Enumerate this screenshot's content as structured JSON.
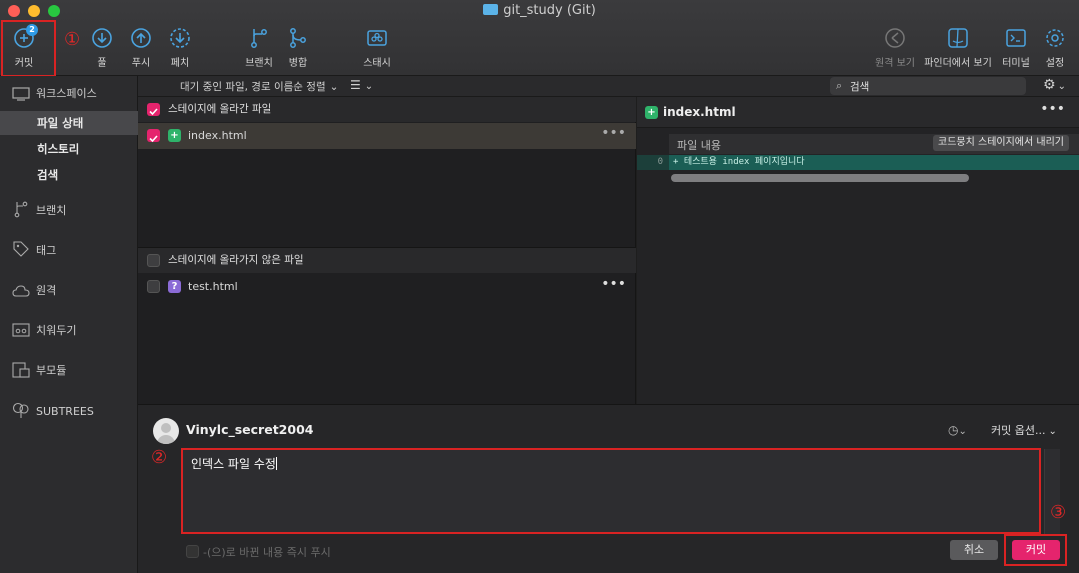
{
  "window": {
    "title": "git_study (Git)"
  },
  "toolbar": {
    "commit_label": "커밋",
    "commit_badge": "2",
    "pull_label": "풀",
    "push_label": "푸시",
    "fetch_label": "페치",
    "branch_label": "브랜치",
    "merge_label": "병합",
    "stash_label": "스태시",
    "remote_label": "원격 보기",
    "finder_label": "파인더에서 보기",
    "terminal_label": "터미널",
    "settings_label": "설정"
  },
  "annotations": {
    "one": "①",
    "two": "②",
    "three": "③"
  },
  "sidebar": {
    "workspace": "워크스페이스",
    "file_status": "파일 상태",
    "history": "히스토리",
    "search": "검색",
    "branches": "브랜치",
    "tags": "태그",
    "remotes": "원격",
    "stashes": "치워두기",
    "submodules": "부모듈",
    "subtrees": "SUBTREES"
  },
  "listbar": {
    "sort_label": "대기 중인 파일, 경로 이름순 정렬",
    "search_placeholder": "검색"
  },
  "staged": {
    "header": "스테이지에 올라간 파일",
    "files": [
      {
        "name": "index.html",
        "status": "added",
        "checked": true
      }
    ]
  },
  "unstaged": {
    "header": "스테이지에 올라가지 않은 파일",
    "files": [
      {
        "name": "test.html",
        "status": "untracked",
        "checked": false
      }
    ]
  },
  "diff": {
    "file_name": "index.html",
    "hunk_label": "파일 내용",
    "unstage_button": "코드뭉치 스테이지에서 내리기",
    "line_number": "0",
    "added_line": "+ 테스트용 index 페이지입니다"
  },
  "commit": {
    "author": "Vinylc_secret2004",
    "options_label": "커밋 옵션...",
    "message": "인덱스 파일 수정",
    "push_immediately": "-(으)로 바뀐 내용 즉시 푸시",
    "cancel_label": "취소",
    "commit_label": "커밋"
  },
  "colors": {
    "accent": "#e5246d",
    "annotation": "#d92323",
    "added": "#1b5e55"
  }
}
